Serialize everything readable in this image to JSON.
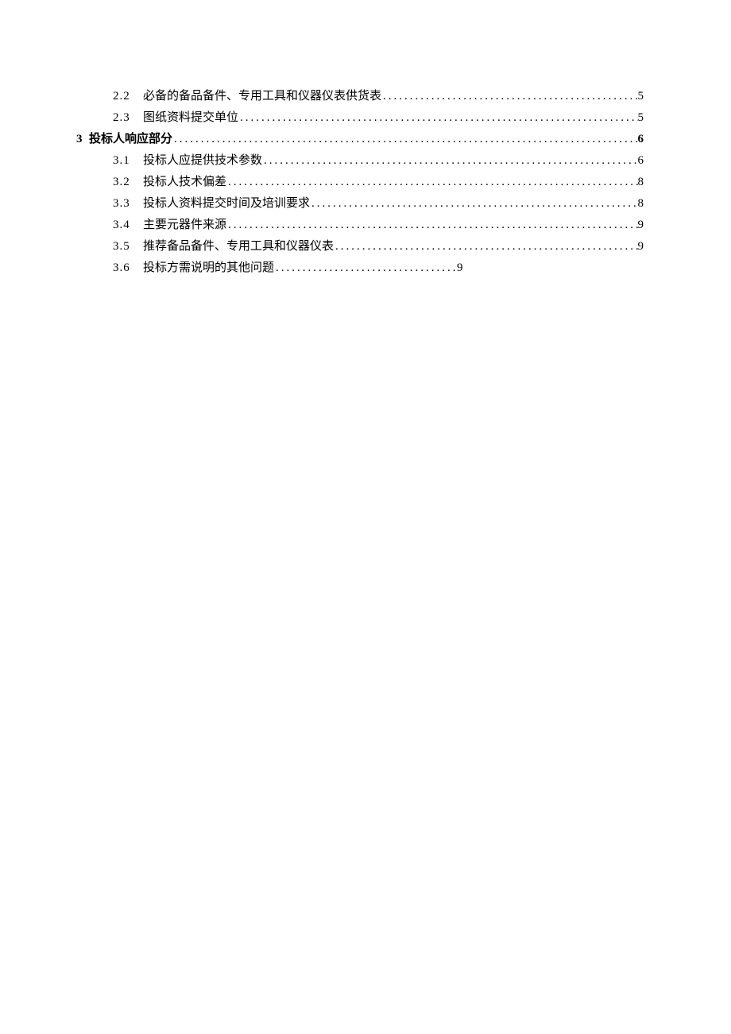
{
  "toc": [
    {
      "chapter": "",
      "section": "2.2",
      "title": "必备的备品备件、专用工具和仪器仪表供货表",
      "page": "5",
      "bold": false,
      "short": false
    },
    {
      "chapter": "",
      "section": "2.3",
      "title": "图纸资料提交单位",
      "page": "5",
      "bold": false,
      "short": false
    },
    {
      "chapter": "3",
      "section": "",
      "title": "投标人响应部分",
      "page": "6",
      "bold": true,
      "short": false
    },
    {
      "chapter": "",
      "section": "3.1",
      "title": "投标人应提供技术参数",
      "page": "6",
      "bold": false,
      "short": false
    },
    {
      "chapter": "",
      "section": "3.2",
      "title": "投标人技术偏差",
      "page": "8",
      "bold": false,
      "short": false
    },
    {
      "chapter": "",
      "section": "3.3",
      "title": "投标人资料提交时间及培训要求",
      "page": "8",
      "bold": false,
      "short": false
    },
    {
      "chapter": "",
      "section": "3.4",
      "title": "主要元器件来源",
      "page": "9",
      "bold": false,
      "short": false
    },
    {
      "chapter": "",
      "section": "3.5",
      "title": "推荐备品备件、专用工具和仪器仪表",
      "page": "9",
      "bold": false,
      "short": false
    },
    {
      "chapter": "",
      "section": "3.6",
      "title": "投标方需说明的其他问题",
      "page": "9",
      "bold": false,
      "short": true
    }
  ]
}
